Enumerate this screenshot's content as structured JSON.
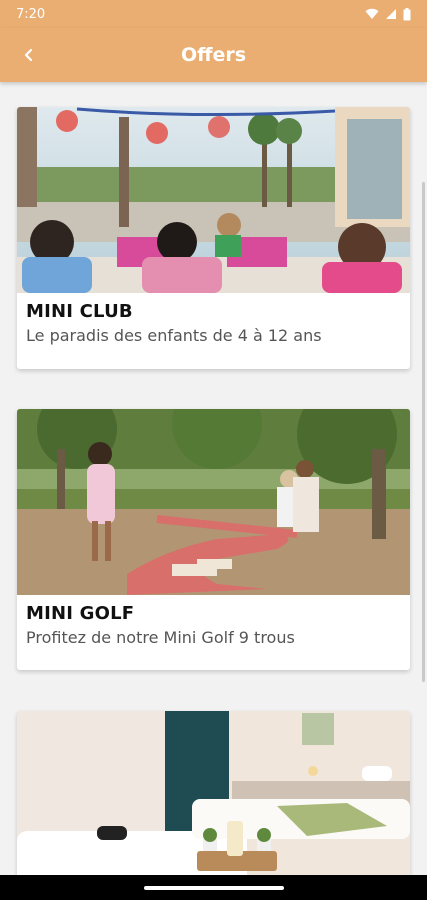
{
  "status_bar": {
    "time": "7:20",
    "icons": [
      "wifi-icon",
      "signal-icon",
      "battery-icon"
    ]
  },
  "app_bar": {
    "back_icon": "arrow-back-icon",
    "title": "Offers"
  },
  "colors": {
    "accent": "#eaae72",
    "background": "#f2f2f2",
    "card": "#ffffff",
    "title_text": "#111111",
    "subtitle_text": "#555555"
  },
  "offers": [
    {
      "name": "MINI CLUB",
      "description": "Le paradis des enfants de 4 à 12 ans",
      "image": "kids-club-photo"
    },
    {
      "name": "MINI GOLF",
      "description": "Profitez de notre Mini Golf 9 trous",
      "image": "mini-golf-photo"
    },
    {
      "name": "",
      "description": "",
      "image": "spa-room-photo"
    }
  ]
}
